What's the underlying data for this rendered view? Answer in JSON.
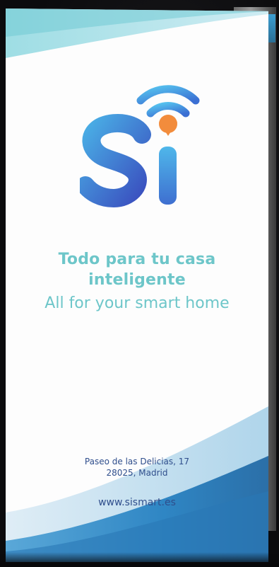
{
  "brochure": {
    "brand_mark": "Si",
    "tagline_es_line1": "Todo para tu casa",
    "tagline_es_line2": "inteligente",
    "tagline_en": "All for your smart home",
    "address_line1": "Paseo de las Delicias, 17",
    "address_line2": "28025, Madrid",
    "website": "www.sismart.es"
  },
  "icons": {
    "logo": "si-wifi-logo-icon"
  },
  "colors": {
    "logo_gradient_start": "#3a57c2",
    "logo_gradient_end": "#4fb7ea",
    "wifi_dot": "#f28c3c",
    "tagline": "#6dc6c9",
    "contact_text": "#2f4e8c",
    "wave_dark": "#2f7db8",
    "wave_light": "#a9d6ee",
    "background": "#0d0d0f"
  }
}
